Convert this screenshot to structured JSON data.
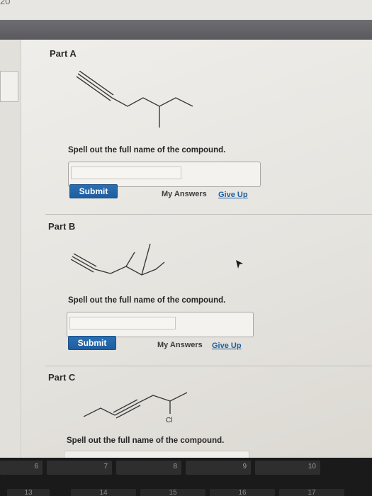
{
  "corner_number": "20",
  "parts": [
    {
      "title": "Part A",
      "prompt": "Spell out the full name of the compound.",
      "submit_label": "Submit",
      "my_answers_label": "My Answers",
      "give_up_label": "Give Up"
    },
    {
      "title": "Part B",
      "prompt": "Spell out the full name of the compound.",
      "submit_label": "Submit",
      "my_answers_label": "My Answers",
      "give_up_label": "Give Up"
    },
    {
      "title": "Part C",
      "prompt": "Spell out the full name of the compound.",
      "atom_label": "Cl"
    }
  ],
  "keyboard": {
    "fkeys": [
      "6",
      "7",
      "8",
      "9",
      "10"
    ],
    "number_keys": [
      "13",
      "14",
      "15",
      "16",
      "17"
    ]
  },
  "colors": {
    "submit_button": "#1f5e9f",
    "give_up_link": "#1f5e9f",
    "header_bar": "#5a5a5e"
  }
}
